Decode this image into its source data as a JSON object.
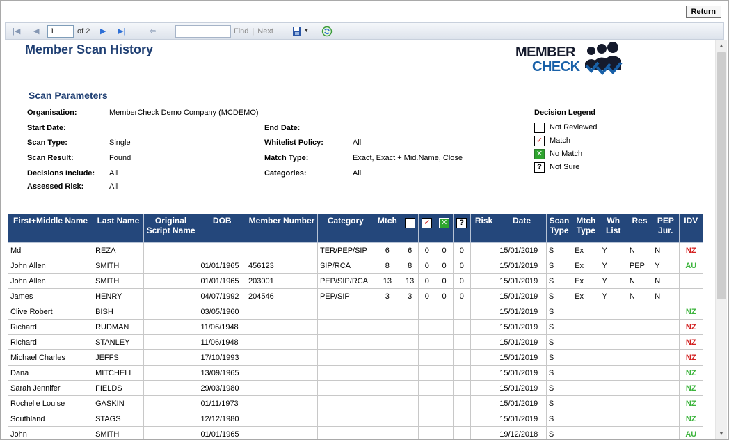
{
  "window": {
    "return_label": "Return"
  },
  "toolbar": {
    "page": "1",
    "of_label": "of 2",
    "find_placeholder": "",
    "find_label": "Find",
    "separator": "|",
    "next_label": "Next",
    "icons": [
      "first-page-icon",
      "prev-page-icon",
      "next-page-icon",
      "last-page-icon",
      "back-icon",
      "export-save-icon",
      "refresh-icon"
    ]
  },
  "report": {
    "title": "Member Scan History",
    "logo_top": "MEMBER",
    "logo_bottom": "CHECK",
    "scan_parameters_title": "Scan Parameters",
    "params_left": [
      {
        "label": "Organisation:",
        "value": "MemberCheck Demo Company (MCDEMO)"
      },
      {
        "label": "Start Date:",
        "value": ""
      },
      {
        "label": "Scan Type:",
        "value": "Single"
      },
      {
        "label": "Scan Result:",
        "value": "Found"
      },
      {
        "label": "Decisions Include:",
        "value": "All"
      },
      {
        "label": "Assessed Risk:",
        "value": "All"
      }
    ],
    "params_right": [
      {
        "label": "End Date:",
        "value": ""
      },
      {
        "label": "Whitelist Policy:",
        "value": "All"
      },
      {
        "label": "Match Type:",
        "value": "Exact, Exact + Mid.Name, Close"
      },
      {
        "label": "Categories:",
        "value": "All"
      }
    ],
    "legend": {
      "title": "Decision Legend",
      "items": [
        {
          "symbol": "",
          "label": "Not Reviewed"
        },
        {
          "symbol": "✓",
          "label": "Match"
        },
        {
          "symbol": "✕",
          "label": "No Match"
        },
        {
          "symbol": "?",
          "label": "Not Sure"
        }
      ]
    }
  },
  "table": {
    "headers": [
      "First+Middle Name",
      "Last Name",
      "Original Script Name",
      "DOB",
      "Member Number",
      "Category",
      "Mtch",
      "",
      "✓",
      "✕",
      "?",
      "Risk",
      "Date",
      "Scan Type",
      "Mtch Type",
      "Wh List",
      "Res",
      "PEP Jur.",
      "IDV"
    ],
    "rows": [
      [
        "Md",
        "REZA",
        "",
        "",
        "",
        "TER/PEP/SIP",
        "6",
        "6",
        "0",
        "0",
        "0",
        "",
        "15/01/2019",
        "S",
        "Ex",
        "Y",
        "N",
        "N",
        "NZ"
      ],
      [
        "John Allen",
        "SMITH",
        "",
        "01/01/1965",
        "456123",
        "SIP/RCA",
        "8",
        "8",
        "0",
        "0",
        "0",
        "",
        "15/01/2019",
        "S",
        "Ex",
        "Y",
        "PEP",
        "Y",
        "AU"
      ],
      [
        "John Allen",
        "SMITH",
        "",
        "01/01/1965",
        "203001",
        "PEP/SIP/RCA",
        "13",
        "13",
        "0",
        "0",
        "0",
        "",
        "15/01/2019",
        "S",
        "Ex",
        "Y",
        "N",
        "N",
        ""
      ],
      [
        "James",
        "HENRY",
        "",
        "04/07/1992",
        "204546",
        "PEP/SIP",
        "3",
        "3",
        "0",
        "0",
        "0",
        "",
        "15/01/2019",
        "S",
        "Ex",
        "Y",
        "N",
        "N",
        ""
      ],
      [
        "Clive Robert",
        "BISH",
        "",
        "03/05/1960",
        "",
        "",
        "",
        "",
        "",
        "",
        "",
        "",
        "15/01/2019",
        "S",
        "",
        "",
        "",
        "",
        "NZ"
      ],
      [
        "Richard",
        "RUDMAN",
        "",
        "11/06/1948",
        "",
        "",
        "",
        "",
        "",
        "",
        "",
        "",
        "15/01/2019",
        "S",
        "",
        "",
        "",
        "",
        "NZ"
      ],
      [
        "Richard",
        "STANLEY",
        "",
        "11/06/1948",
        "",
        "",
        "",
        "",
        "",
        "",
        "",
        "",
        "15/01/2019",
        "S",
        "",
        "",
        "",
        "",
        "NZ"
      ],
      [
        "Michael Charles",
        "JEFFS",
        "",
        "17/10/1993",
        "",
        "",
        "",
        "",
        "",
        "",
        "",
        "",
        "15/01/2019",
        "S",
        "",
        "",
        "",
        "",
        "NZ"
      ],
      [
        "Dana",
        "MITCHELL",
        "",
        "13/09/1965",
        "",
        "",
        "",
        "",
        "",
        "",
        "",
        "",
        "15/01/2019",
        "S",
        "",
        "",
        "",
        "",
        "NZ"
      ],
      [
        "Sarah Jennifer",
        "FIELDS",
        "",
        "29/03/1980",
        "",
        "",
        "",
        "",
        "",
        "",
        "",
        "",
        "15/01/2019",
        "S",
        "",
        "",
        "",
        "",
        "NZ"
      ],
      [
        "Rochelle Louise",
        "GASKIN",
        "",
        "01/11/1973",
        "",
        "",
        "",
        "",
        "",
        "",
        "",
        "",
        "15/01/2019",
        "S",
        "",
        "",
        "",
        "",
        "NZ"
      ],
      [
        "Southland",
        "STAGS",
        "",
        "12/12/1980",
        "",
        "",
        "",
        "",
        "",
        "",
        "",
        "",
        "15/01/2019",
        "S",
        "",
        "",
        "",
        "",
        "NZ"
      ],
      [
        "John",
        "SMITH",
        "",
        "01/01/1965",
        "",
        "",
        "",
        "",
        "",
        "",
        "",
        "",
        "19/12/2018",
        "S",
        "",
        "",
        "",
        "",
        "AU"
      ]
    ],
    "idv_colors": [
      "red",
      "green",
      "",
      "",
      "green",
      "red",
      "red",
      "red",
      "green",
      "green",
      "green",
      "green",
      "green"
    ]
  }
}
